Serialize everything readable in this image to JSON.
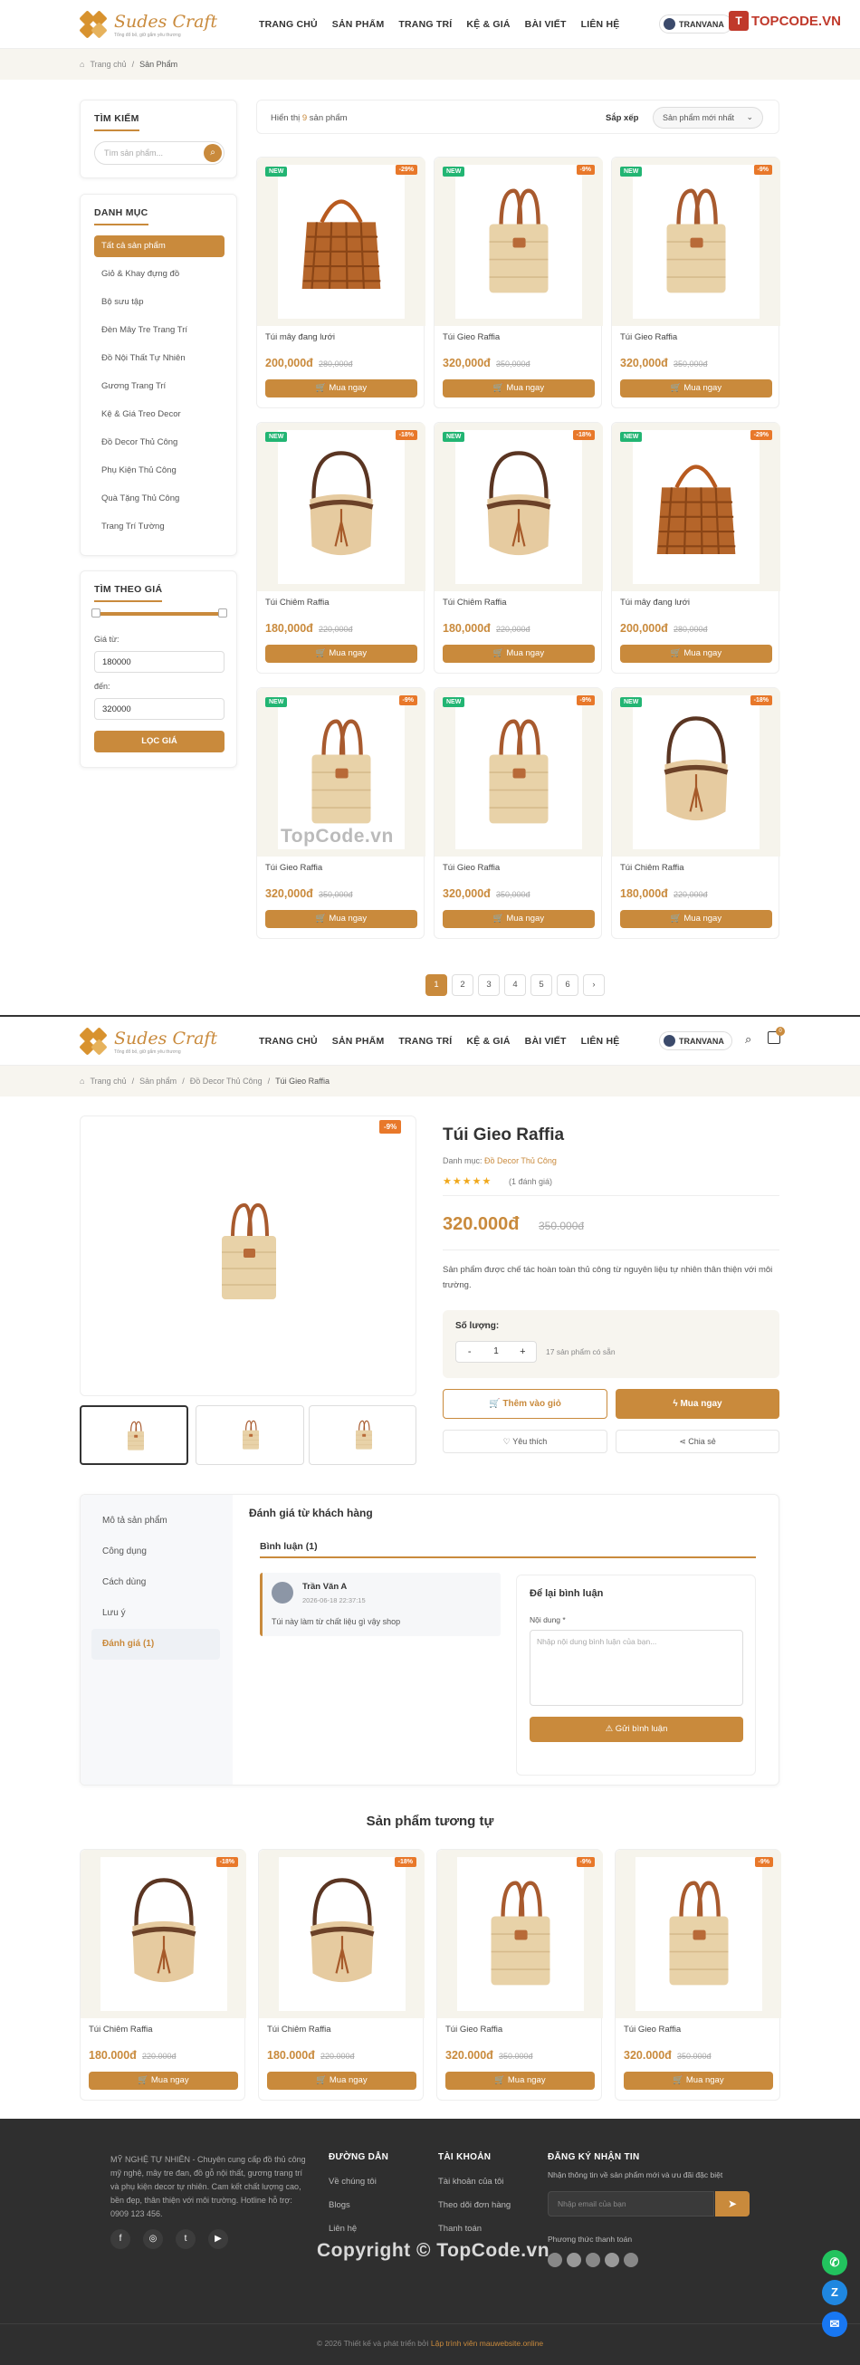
{
  "brand": {
    "name": "Sudes Craft",
    "tagline": "Tổng đổ bỏ, giữ gắm yêu thương"
  },
  "nav": [
    "TRANG CHỦ",
    "SẢN PHẨM",
    "TRANG TRÍ",
    "KỆ & GIÁ",
    "BÀI VIẾT",
    "LIÊN HỆ"
  ],
  "user": {
    "name": "TRANVANA"
  },
  "watermark_top": "TOPCODE.VN",
  "cart_count": "0",
  "listing": {
    "breadcrumb": [
      "Trang chủ",
      "Sản Phẩm"
    ],
    "search_title": "TÌM KIẾM",
    "search_placeholder": "Tìm sản phẩm...",
    "category_title": "DANH MỤC",
    "categories": [
      "Tất cả sản phẩm",
      "Giỏ & Khay đựng đồ",
      "Bộ sưu tập",
      "Đèn Mây Tre Trang Trí",
      "Đồ Nội Thất Tự Nhiên",
      "Gương Trang Trí",
      "Kệ & Giá Treo Decor",
      "Đồ Decor Thủ Công",
      "Phụ Kiện Thủ Công",
      "Quà Tặng Thủ Công",
      "Trang Trí Tường"
    ],
    "price_title": "TÌM THEO GIÁ",
    "price_from_label": "Giá từ:",
    "price_from": "180000",
    "price_to_label": "đến:",
    "price_to": "320000",
    "filter_btn": "LỌC GIÁ",
    "showing_prefix": "Hiển thị",
    "showing_count": "9",
    "showing_suffix": "sản phẩm",
    "sort_label": "Sắp xếp",
    "sort_value": "Sản phẩm mới nhất",
    "new_badge": "NEW",
    "buy_label": "Mua ngay",
    "products": [
      {
        "name": "Túi mây đang lưới",
        "price": "200,000đ",
        "old": "280,000đ",
        "off": "-29%",
        "kind": "woven"
      },
      {
        "name": "Túi Gieo Raffia",
        "price": "320,000đ",
        "old": "350,000đ",
        "off": "-9%",
        "kind": "tote"
      },
      {
        "name": "Túi Gieo Raffia",
        "price": "320,000đ",
        "old": "350,000đ",
        "off": "-9%",
        "kind": "tote"
      },
      {
        "name": "Túi Chiêm Raffia",
        "price": "180,000đ",
        "old": "220,000đ",
        "off": "-18%",
        "kind": "bucket"
      },
      {
        "name": "Túi Chiêm Raffia",
        "price": "180,000đ",
        "old": "220,000đ",
        "off": "-18%",
        "kind": "bucket"
      },
      {
        "name": "Túi mây đang lưới",
        "price": "200,000đ",
        "old": "280,000đ",
        "off": "-29%",
        "kind": "woven"
      },
      {
        "name": "Túi Gieo Raffia",
        "price": "320,000đ",
        "old": "350,000đ",
        "off": "-9%",
        "kind": "tote"
      },
      {
        "name": "Túi Gieo Raffia",
        "price": "320,000đ",
        "old": "350,000đ",
        "off": "-9%",
        "kind": "tote"
      },
      {
        "name": "Túi Chiêm Raffia",
        "price": "180,000đ",
        "old": "220,000đ",
        "off": "-18%",
        "kind": "bucket"
      }
    ],
    "pages": [
      "1",
      "2",
      "3",
      "4",
      "5",
      "6",
      "›"
    ],
    "watermark": "TopCode.vn"
  },
  "detail": {
    "breadcrumb": [
      "Trang chủ",
      "Sản phẩm",
      "Đồ Decor Thủ Công",
      "Túi Gieo Raffia"
    ],
    "off": "-9%",
    "title": "Túi Gieo Raffia",
    "category_label": "Danh mục:",
    "category": "Đồ Decor Thủ Công",
    "rating_count": "(1 đánh giá)",
    "rating": 5,
    "price": "320.000đ",
    "old_price": "350.000đ",
    "description": "Sản phẩm được chế tác hoàn toàn thủ công từ nguyên liệu tự nhiên thân thiện với môi trường.",
    "qty_label": "Số lượng:",
    "qty": "1",
    "stock": "17 sản phẩm có sẵn",
    "add_cart": "Thêm vào giỏ",
    "buy_now": "Mua ngay",
    "wishlist": "Yêu thích",
    "share": "Chia sẻ",
    "tabs": [
      "Mô tả sản phẩm",
      "Công dụng",
      "Cách dùng",
      "Lưu ý",
      "Đánh giá (1)"
    ],
    "reviews_title": "Đánh giá từ khách hàng",
    "comments_tab": "Bình luận (1)",
    "review": {
      "author": "Trần Văn A",
      "date": "2026-06-18 22:37:15",
      "text": "Túi này làm từ chất liệu gì vậy shop"
    },
    "leave_title": "Để lại bình luận",
    "content_label": "Nội dung *",
    "content_placeholder": "Nhập nội dung bình luận của bạn...",
    "submit": "Gửi bình luận",
    "related_title": "Sản phẩm tương tự",
    "related": [
      {
        "name": "Túi Chiêm Raffia",
        "price": "180.000đ",
        "old": "220.000đ",
        "off": "-18%",
        "kind": "bucket"
      },
      {
        "name": "Túi Chiêm Raffia",
        "price": "180.000đ",
        "old": "220.000đ",
        "off": "-18%",
        "kind": "bucket"
      },
      {
        "name": "Túi Gieo Raffia",
        "price": "320.000đ",
        "old": "350.000đ",
        "off": "-9%",
        "kind": "tote"
      },
      {
        "name": "Túi Gieo Raffia",
        "price": "320.000đ",
        "old": "350.000đ",
        "off": "-9%",
        "kind": "tote"
      }
    ]
  },
  "footer": {
    "about": "MỸ NGHỆ TỰ NHIÊN - Chuyên cung cấp đồ thủ công mỹ nghệ, mây tre đan, đồ gỗ nội thất, gương trang trí và phụ kiện decor tự nhiên. Cam kết chất lượng cao, bền đẹp, thân thiện với môi trường. Hotline hỗ trợ: 0909 123 456.",
    "col1_title": "ĐƯỜNG DẪN",
    "col1": [
      "Về chúng tôi",
      "Blogs",
      "Liên hệ"
    ],
    "col2_title": "TÀI KHOẢN",
    "col2": [
      "Tài khoản của tôi",
      "Theo dõi đơn hàng",
      "Thanh toán"
    ],
    "col3_title": "ĐĂNG KÝ NHẬN TIN",
    "col3_text": "Nhận thông tin về sản phẩm mới và ưu đãi đặc biệt",
    "email_placeholder": "Nhập email của bạn",
    "payment_title": "Phương thức thanh toán",
    "copyright_wm": "Copyright © TopCode.vn",
    "bottom_prefix": "© 2026 Thiết kế và phát triển bởi",
    "bottom_link": "Lập trình viên mauwebsite.online"
  },
  "colors": {
    "accent": "#c98a3c",
    "new": "#22b573",
    "off": "#e8782a",
    "footer": "#2f2f2f"
  }
}
